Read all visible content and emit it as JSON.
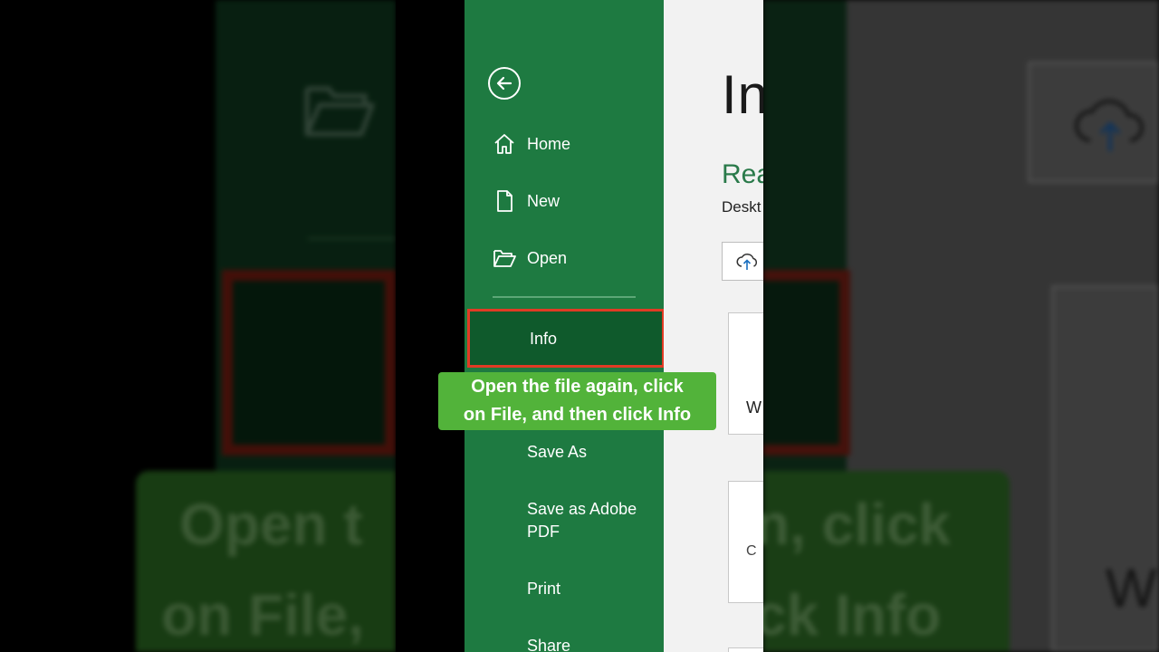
{
  "sidebar": {
    "back_icon": "back-arrow-icon",
    "items": [
      {
        "label": "Home",
        "icon": "home-icon"
      },
      {
        "label": "New",
        "icon": "new-document-icon"
      },
      {
        "label": "Open",
        "icon": "folder-open-icon"
      }
    ],
    "info": {
      "label": "Info"
    },
    "lower_items": [
      {
        "label": "Save As"
      },
      {
        "label": "Save as Adobe PDF"
      },
      {
        "label": "Print"
      },
      {
        "label": "Share"
      }
    ],
    "accent_color": "#1e7a41",
    "highlight_color": "#e03b24"
  },
  "caption": {
    "line1": "Open the file again, click",
    "line2": "on File, and then click Info",
    "bg_color": "#52b33a"
  },
  "content": {
    "title_partial": "In",
    "section_partial": "Rea",
    "path_partial": "Deskt",
    "upload_icon": "cloud-upload-icon",
    "card1_partial": "W",
    "card2_partial": "C"
  },
  "background": {
    "left_text_line1": "Open t",
    "left_text_line2": "on File,",
    "right_text_line1": "n, click",
    "right_text_line2": "ck Info",
    "right_card_text": "W"
  }
}
